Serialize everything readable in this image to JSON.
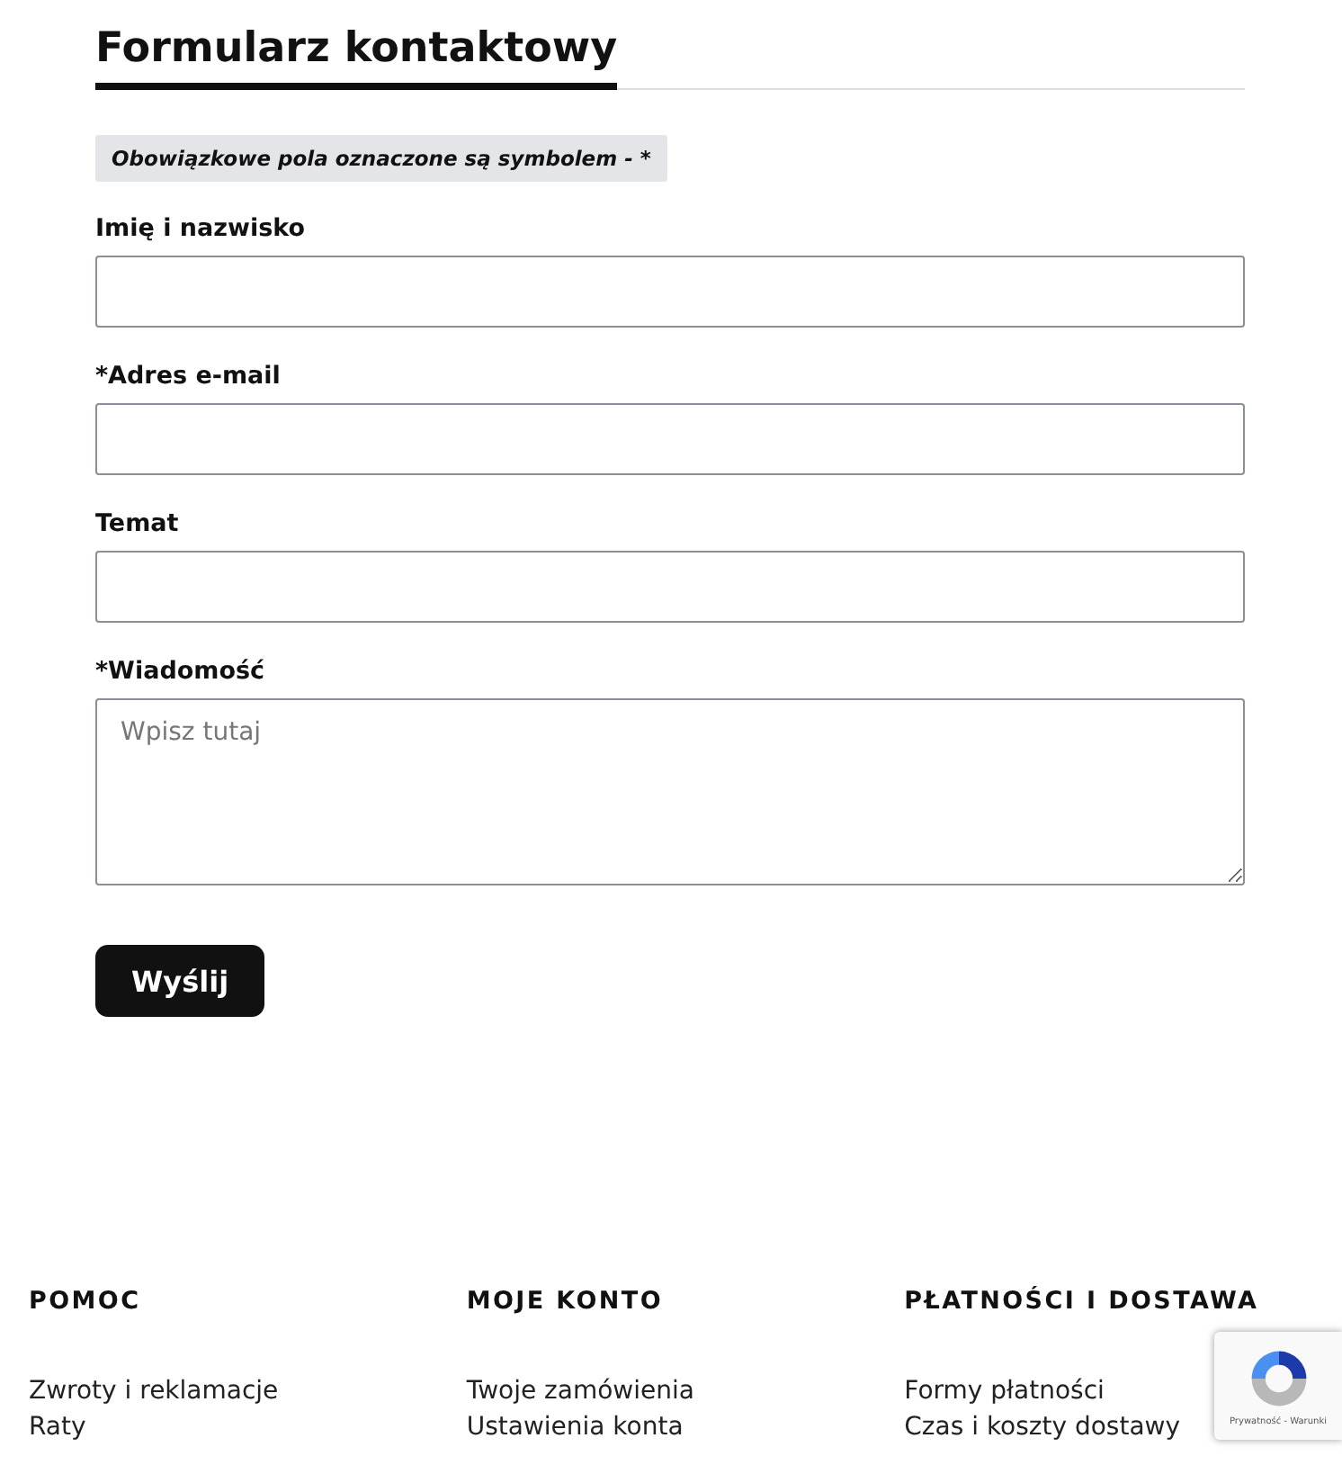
{
  "title": "Formularz kontaktowy",
  "note": "Obowiązkowe pola oznaczone są symbolem - *",
  "fields": [
    {
      "kind": "input",
      "label": "Imię i nazwisko"
    },
    {
      "kind": "input",
      "label": "*Adres e-mail"
    },
    {
      "kind": "input",
      "label": "Temat"
    },
    {
      "kind": "textarea",
      "label": "*Wiadomość",
      "placeholder": "Wpisz tutaj"
    }
  ],
  "submit": "Wyślij",
  "footer": [
    {
      "heading": "POMOC",
      "links": [
        "Zwroty i reklamacje",
        "Raty"
      ]
    },
    {
      "heading": "MOJE KONTO",
      "links": [
        "Twoje zamówienia",
        "Ustawienia konta"
      ]
    },
    {
      "heading": "PŁATNOŚCI I DOSTAWA",
      "links": [
        "Formy płatności",
        "Czas i koszty dostawy"
      ]
    }
  ],
  "recaptcha": {
    "text": "Prywatność - Warunki"
  }
}
